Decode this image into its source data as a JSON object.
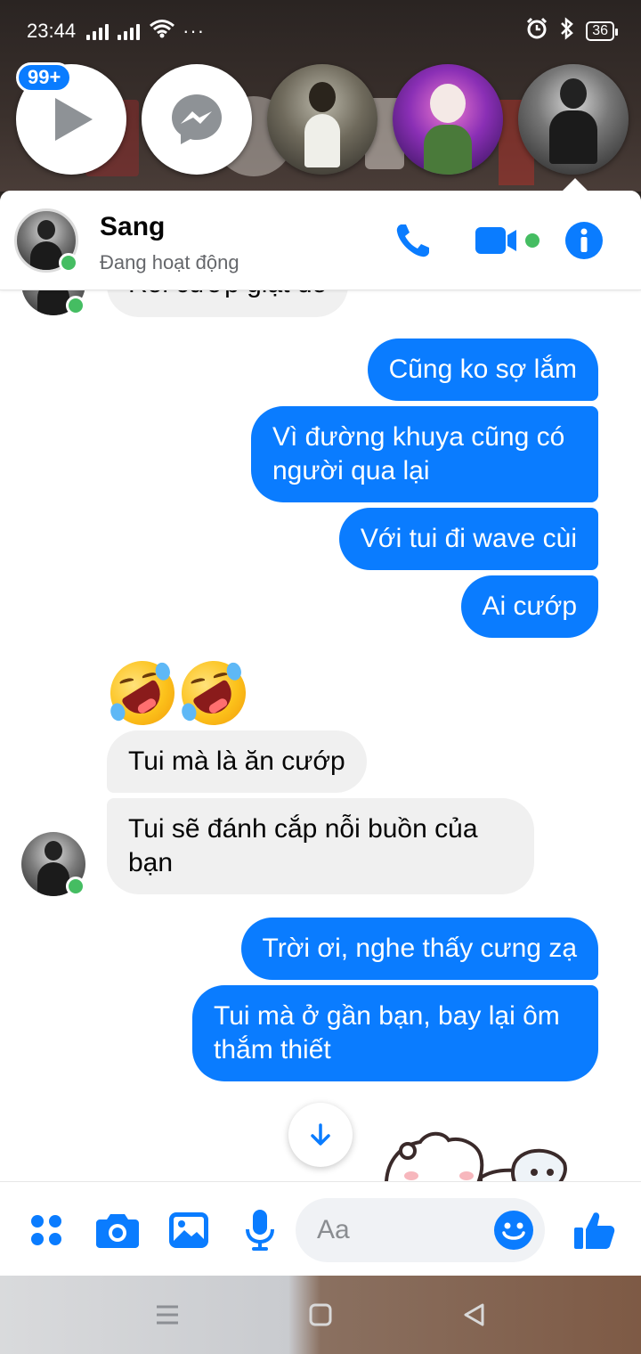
{
  "statusbar": {
    "time": "23:44",
    "dots": "···",
    "battery": "36"
  },
  "chat_heads": {
    "badge": "99+"
  },
  "header": {
    "name": "Sang",
    "status": "Đang hoạt động"
  },
  "messages": {
    "top_partial": "Rồi cướp giật đó",
    "out1": "Cũng ko sợ lắm",
    "out2_line1": "Vì đường khuya cũng có",
    "out2_line2": "người qua lại",
    "out3": "Với tui đi wave cùi",
    "out4": "Ai cướp",
    "in1": "Tui mà là ăn cướp",
    "in2_line1": "Tui sẽ đánh cắp nỗi buồn của",
    "in2_line2": "bạn",
    "out5": "Trời ơi, nghe thấy cưng zạ",
    "out6_line1": "Tui mà ở gần bạn, bay lại ôm",
    "out6_line2": "thắm thiết"
  },
  "composer": {
    "placeholder": "Aa"
  },
  "colors": {
    "accent": "#0a7cff",
    "online": "#45bd62",
    "incoming_bubble": "#f0f0f0"
  },
  "icons": {
    "header": [
      "phone-icon",
      "video-icon",
      "info-icon"
    ],
    "composer": [
      "menu-dots-icon",
      "camera-icon",
      "gallery-icon",
      "microphone-icon",
      "emoji-icon",
      "like-icon"
    ]
  }
}
